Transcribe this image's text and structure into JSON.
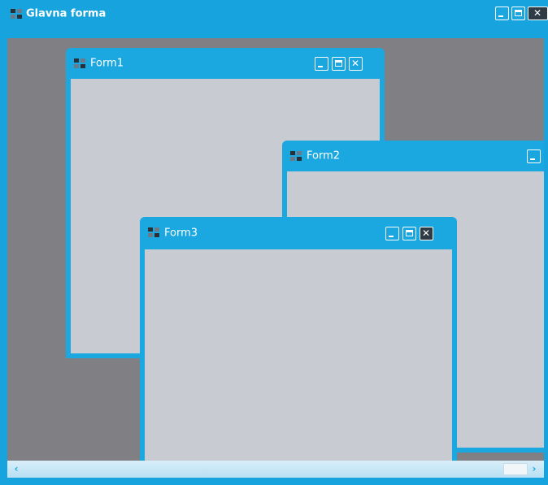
{
  "main_window": {
    "title": "Glavna forma"
  },
  "children": [
    {
      "title": "Form1"
    },
    {
      "title": "Form2"
    },
    {
      "title": "Form3"
    }
  ],
  "colors": {
    "titlebar": "#17a3dd",
    "mdi_background": "#808084",
    "client_area": "#c8ccd2",
    "close_button": "#2e3b44"
  },
  "scrollbar": {
    "left_arrow": "‹",
    "right_arrow": "›"
  },
  "icons": [
    "app-icon",
    "minimize-icon",
    "maximize-icon",
    "close-icon",
    "chevron-left-icon",
    "chevron-right-icon"
  ]
}
